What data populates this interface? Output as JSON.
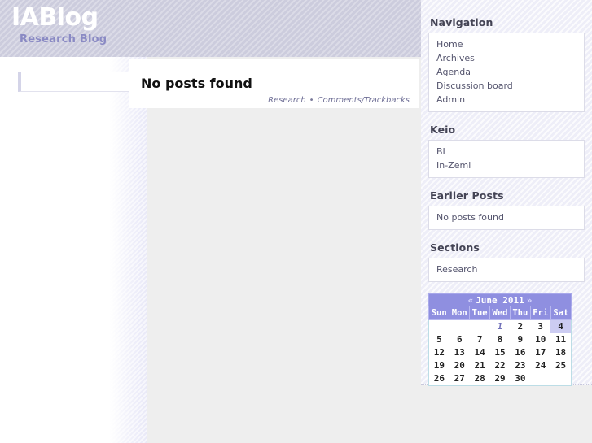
{
  "header": {
    "title": "IABlog",
    "subtitle": "Research Blog"
  },
  "main": {
    "post_title": "No posts found",
    "meta": {
      "section_link": "Research",
      "separator": "•",
      "comments_link": "Comments/Trackbacks"
    }
  },
  "sidebar": {
    "blocks": [
      {
        "heading": "Navigation",
        "items": [
          "Home",
          "Archives",
          "Agenda",
          "Discussion board",
          "Admin"
        ]
      },
      {
        "heading": "Keio",
        "items": [
          "BI",
          "In-Zemi"
        ]
      },
      {
        "heading": "Earlier Posts",
        "items": [
          "No posts found"
        ]
      },
      {
        "heading": "Sections",
        "items": [
          "Research"
        ]
      }
    ]
  },
  "calendar": {
    "prev_label": "«",
    "month_label": "June 2011",
    "next_label": "»",
    "weekdays": [
      "Sun",
      "Mon",
      "Tue",
      "Wed",
      "Thu",
      "Fri",
      "Sat"
    ],
    "today": 4,
    "linked_days": [
      1
    ],
    "weeks": [
      [
        "",
        "",
        "",
        "1",
        "2",
        "3",
        "4"
      ],
      [
        "5",
        "6",
        "7",
        "8",
        "9",
        "10",
        "11"
      ],
      [
        "12",
        "13",
        "14",
        "15",
        "16",
        "17",
        "18"
      ],
      [
        "19",
        "20",
        "21",
        "22",
        "23",
        "24",
        "25"
      ],
      [
        "26",
        "27",
        "28",
        "29",
        "30",
        "",
        ""
      ]
    ]
  },
  "colors": {
    "header_band": "#ccccdd",
    "title_white": "#ffffff",
    "subtitle_purple": "#8a8ac4",
    "sidebar_bg": "#eeeef8",
    "calendar_header": "#8f8fe0",
    "calendar_today": "#ccccf2",
    "content_plate": "#eeeeee"
  }
}
